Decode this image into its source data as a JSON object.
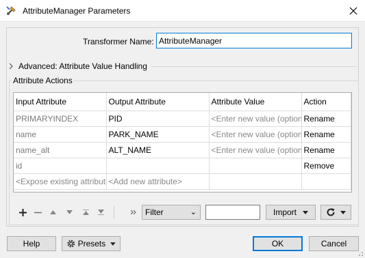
{
  "window": {
    "title": "AttributeManager Parameters"
  },
  "transformer": {
    "label": "Transformer Name:",
    "value": "AttributeManager"
  },
  "advanced": {
    "label": "Advanced: Attribute Value Handling"
  },
  "actions": {
    "group_title": "Attribute Actions",
    "columns": [
      "Input Attribute",
      "Output Attribute",
      "Attribute Value",
      "Action"
    ],
    "rows": [
      [
        "PRIMARYINDEX",
        "PID",
        "<Enter new value (option",
        "Rename"
      ],
      [
        "name",
        "PARK_NAME",
        "<Enter new value (option",
        "Rename"
      ],
      [
        "name_alt",
        "ALT_NAME",
        "<Enter new value (option",
        "Rename"
      ],
      [
        "id",
        "",
        "",
        "Remove"
      ],
      [
        "<Expose existing attribute",
        "<Add new attribute>",
        "",
        ""
      ]
    ]
  },
  "toolbar": {
    "filter_label": "Filter",
    "import_label": "Import",
    "add_icon": "plus-icon",
    "remove_icon": "minus-icon",
    "refresh_icon": "refresh-icon"
  },
  "buttons": {
    "help": "Help",
    "presets": "Presets",
    "ok": "OK",
    "cancel": "Cancel"
  },
  "colors": {
    "accent": "#0078d7",
    "hint_text": "#888888",
    "input_attr_text": "#7a7a7a"
  }
}
